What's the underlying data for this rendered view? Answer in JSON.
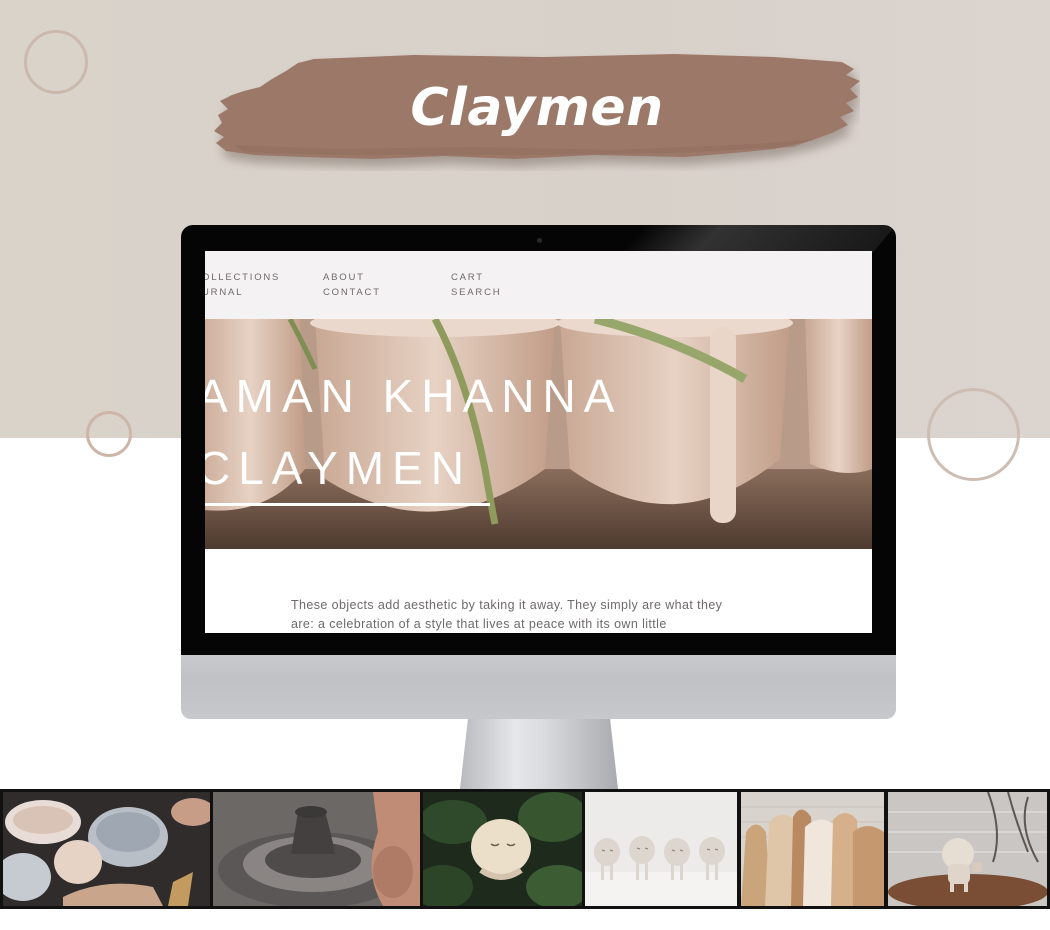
{
  "brand": {
    "title": "Claymen"
  },
  "site": {
    "nav": {
      "col1": [
        "OLLECTIONS",
        "URNAL"
      ],
      "col2": [
        "ABOUT",
        "CONTACT"
      ],
      "col3": [
        "CART",
        "SEARCH"
      ]
    },
    "hero": {
      "line1": "AMAN KHANNA",
      "line2": "CLAYMEN"
    },
    "intro_line1": "These objects add aesthetic by taking it away. They simply are what they",
    "intro_line2": "are: a celebration of a style that lives at peace with its own little"
  },
  "thumbnails": [
    {
      "name": "ceramic-bowls-thumbnail"
    },
    {
      "name": "pottery-wheel-thumbnail"
    },
    {
      "name": "clay-figure-plants-thumbnail"
    },
    {
      "name": "four-claymen-thumbnail"
    },
    {
      "name": "clay-vases-thumbnail"
    },
    {
      "name": "clayman-on-table-thumbnail"
    }
  ],
  "colors": {
    "brush": "#9c7868",
    "background_top": "#d9d3ca",
    "ring": "#c9b7ac"
  }
}
